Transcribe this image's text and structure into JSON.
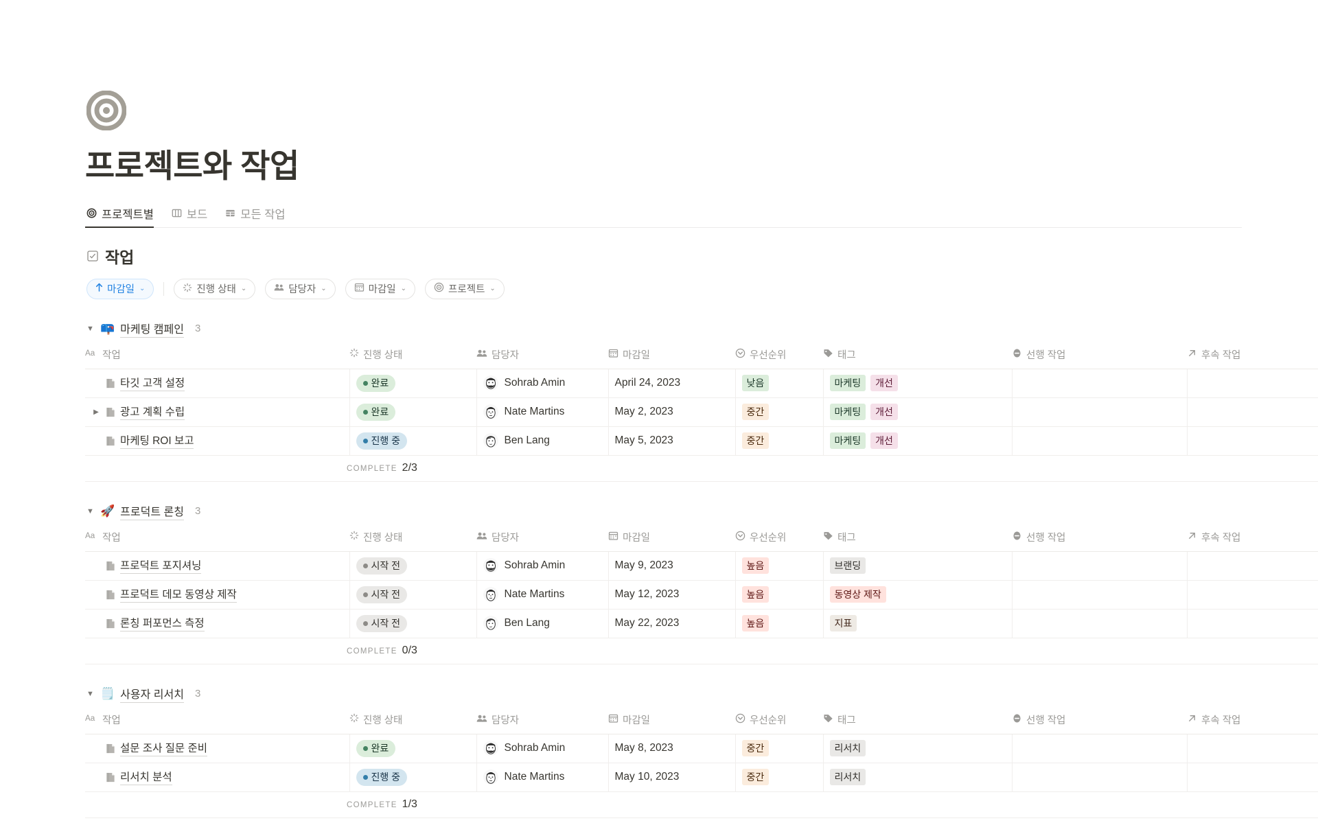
{
  "page": {
    "icon": "target-icon",
    "title": "프로젝트와 작업"
  },
  "tabs": [
    {
      "label": "프로젝트별",
      "icon": "target-icon",
      "active": true
    },
    {
      "label": "보드",
      "icon": "board-icon",
      "active": false
    },
    {
      "label": "모든 작업",
      "icon": "table-icon",
      "active": false
    }
  ],
  "section": {
    "icon": "checkbox-icon",
    "title": "작업"
  },
  "filters": {
    "sort": {
      "label": "마감일",
      "icon": "arrow-up-icon",
      "chevron": "⌄",
      "active": true
    },
    "items": [
      {
        "label": "진행 상태",
        "icon": "loading-icon",
        "chevron": "⌄"
      },
      {
        "label": "담당자",
        "icon": "people-icon",
        "chevron": "⌄"
      },
      {
        "label": "마감일",
        "icon": "calendar-icon",
        "chevron": "⌄"
      },
      {
        "label": "프로젝트",
        "icon": "target-icon",
        "chevron": "⌄"
      }
    ]
  },
  "columns": [
    {
      "label": "작업",
      "icon": "aa-icon"
    },
    {
      "label": "진행 상태",
      "icon": "loading-icon"
    },
    {
      "label": "담당자",
      "icon": "people-icon"
    },
    {
      "label": "마감일",
      "icon": "calendar-icon"
    },
    {
      "label": "우선순위",
      "icon": "priority-icon"
    },
    {
      "label": "태그",
      "icon": "tag-icon"
    },
    {
      "label": "선행 작업",
      "icon": "minus-circle-icon"
    },
    {
      "label": "후속 작업",
      "icon": "arrow-up-right-icon"
    }
  ],
  "complete_label": "COMPLETE",
  "groups": [
    {
      "emoji": "📪",
      "name": "마케팅 캠페인",
      "count": "3",
      "caret": "▼",
      "complete": "2/3",
      "rows": [
        {
          "expandable": false,
          "task": "타깃 고객 설정",
          "status": {
            "text": "완료",
            "bg": "#dbeddb",
            "fg": "#1c3829",
            "dot": "#448361"
          },
          "owner": "Sohrab Amin",
          "avatar": "beard",
          "due": "April 24, 2023",
          "priority": {
            "text": "낮음",
            "bg": "#dbeddb",
            "fg": "#1c3829"
          },
          "tags": [
            {
              "text": "마케팅",
              "bg": "#dbeddb",
              "fg": "#1c3829"
            },
            {
              "text": "개선",
              "bg": "#f5e0e9",
              "fg": "#5d1c37"
            }
          ],
          "pre": "",
          "next": ""
        },
        {
          "expandable": true,
          "task": "광고 계획 수립",
          "status": {
            "text": "완료",
            "bg": "#dbeddb",
            "fg": "#1c3829",
            "dot": "#448361"
          },
          "owner": "Nate Martins",
          "avatar": "short",
          "due": "May 2, 2023",
          "priority": {
            "text": "중간",
            "bg": "#fbecdd",
            "fg": "#49290d"
          },
          "tags": [
            {
              "text": "마케팅",
              "bg": "#dbeddb",
              "fg": "#1c3829"
            },
            {
              "text": "개선",
              "bg": "#f5e0e9",
              "fg": "#5d1c37"
            }
          ],
          "pre": "",
          "next": ""
        },
        {
          "expandable": false,
          "task": "마케팅 ROI 보고",
          "status": {
            "text": "진행 중",
            "bg": "#d3e5ef",
            "fg": "#183347",
            "dot": "#337ea9"
          },
          "owner": "Ben Lang",
          "avatar": "wavy",
          "due": "May 5, 2023",
          "priority": {
            "text": "중간",
            "bg": "#fbecdd",
            "fg": "#49290d"
          },
          "tags": [
            {
              "text": "마케팅",
              "bg": "#dbeddb",
              "fg": "#1c3829"
            },
            {
              "text": "개선",
              "bg": "#f5e0e9",
              "fg": "#5d1c37"
            }
          ],
          "pre": "",
          "next": ""
        }
      ]
    },
    {
      "emoji": "🚀",
      "name": "프로덕트 론칭",
      "count": "3",
      "caret": "▼",
      "complete": "0/3",
      "rows": [
        {
          "expandable": false,
          "task": "프로덕트 포지셔닝",
          "status": {
            "text": "시작 전",
            "bg": "#e9e8e6",
            "fg": "#32302c",
            "dot": "#8d8b87"
          },
          "owner": "Sohrab Amin",
          "avatar": "beard",
          "due": "May 9, 2023",
          "priority": {
            "text": "높음",
            "bg": "#ffe2dd",
            "fg": "#5d1715"
          },
          "tags": [
            {
              "text": "브랜딩",
              "bg": "#e9e8e6",
              "fg": "#32302c"
            }
          ],
          "pre": "",
          "next": ""
        },
        {
          "expandable": false,
          "task": "프로덕트 데모 동영상 제작",
          "status": {
            "text": "시작 전",
            "bg": "#e9e8e6",
            "fg": "#32302c",
            "dot": "#8d8b87"
          },
          "owner": "Nate Martins",
          "avatar": "short",
          "due": "May 12, 2023",
          "priority": {
            "text": "높음",
            "bg": "#ffe2dd",
            "fg": "#5d1715"
          },
          "tags": [
            {
              "text": "동영상 제작",
              "bg": "#ffe2dd",
              "fg": "#5d1715"
            }
          ],
          "pre": "",
          "next": ""
        },
        {
          "expandable": false,
          "task": "론칭 퍼포먼스 측정",
          "status": {
            "text": "시작 전",
            "bg": "#e9e8e6",
            "fg": "#32302c",
            "dot": "#8d8b87"
          },
          "owner": "Ben Lang",
          "avatar": "wavy",
          "due": "May 22, 2023",
          "priority": {
            "text": "높음",
            "bg": "#ffe2dd",
            "fg": "#5d1715"
          },
          "tags": [
            {
              "text": "지표",
              "bg": "#eeeae4",
              "fg": "#442a1e"
            }
          ],
          "pre": "",
          "next": ""
        }
      ]
    },
    {
      "emoji": "🗒️",
      "name": "사용자 리서치",
      "count": "3",
      "caret": "▼",
      "complete": "1/3",
      "rows": [
        {
          "expandable": false,
          "task": "설문 조사 질문 준비",
          "status": {
            "text": "완료",
            "bg": "#dbeddb",
            "fg": "#1c3829",
            "dot": "#448361"
          },
          "owner": "Sohrab Amin",
          "avatar": "beard",
          "due": "May 8, 2023",
          "priority": {
            "text": "중간",
            "bg": "#fbecdd",
            "fg": "#49290d"
          },
          "tags": [
            {
              "text": "리서치",
              "bg": "#e9e8e6",
              "fg": "#32302c"
            }
          ],
          "pre": "",
          "next": ""
        },
        {
          "expandable": false,
          "task": "리서치 분석",
          "status": {
            "text": "진행 중",
            "bg": "#d3e5ef",
            "fg": "#183347",
            "dot": "#337ea9"
          },
          "owner": "Nate Martins",
          "avatar": "short",
          "due": "May 10, 2023",
          "priority": {
            "text": "중간",
            "bg": "#fbecdd",
            "fg": "#49290d"
          },
          "tags": [
            {
              "text": "리서치",
              "bg": "#e9e8e6",
              "fg": "#32302c"
            }
          ],
          "pre": "",
          "next": ""
        }
      ]
    }
  ]
}
